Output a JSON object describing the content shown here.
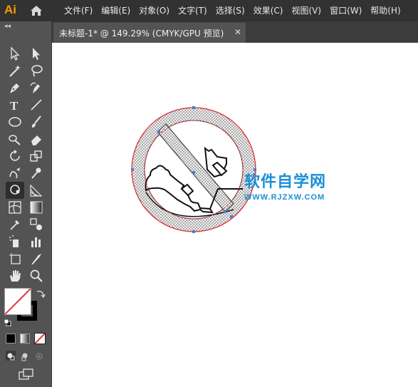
{
  "app": {
    "logo_text": "Ai",
    "logo_color": "#FF9A00"
  },
  "menu": [
    {
      "label": "文件(F)"
    },
    {
      "label": "编辑(E)"
    },
    {
      "label": "对象(O)"
    },
    {
      "label": "文字(T)"
    },
    {
      "label": "选择(S)"
    },
    {
      "label": "效果(C)"
    },
    {
      "label": "视图(V)"
    },
    {
      "label": "窗口(W)"
    },
    {
      "label": "帮助(H)"
    }
  ],
  "document_tab": {
    "label": "未标题-1* @ 149.29% (CMYK/GPU 预览)",
    "close_glyph": "✕"
  },
  "sidebar": {
    "collapse_glyph": "◂◂",
    "active_tool": "lasso-tool",
    "fill_color": "#ffffff",
    "stroke_color": "#000000"
  },
  "artwork": {
    "prohibition_color": "#e8313b",
    "pattern": "dotted-grey"
  },
  "watermark": {
    "cn": "软件自学网",
    "en": "WWW.RJZXW.COM",
    "color": "#1a8fd8"
  }
}
